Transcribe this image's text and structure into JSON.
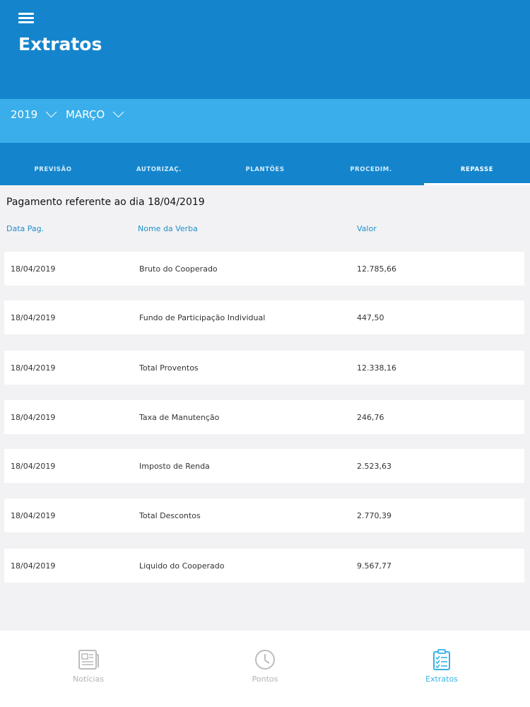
{
  "header": {
    "title": "Extratos"
  },
  "filters": {
    "year": "2019",
    "month": "MARÇO"
  },
  "tabs": [
    {
      "label": "PREVISÃO",
      "active": false
    },
    {
      "label": "AUTORIZAÇ.",
      "active": false
    },
    {
      "label": "PLANTÕES",
      "active": false
    },
    {
      "label": "PROCEDIM.",
      "active": false
    },
    {
      "label": "REPASSE",
      "active": true
    }
  ],
  "statement": {
    "title": "Pagamento referente ao dia 18/04/2019",
    "columns": {
      "date": "Data Pag.",
      "name": "Nome da Verba",
      "value": "Valor"
    },
    "rows": [
      {
        "date": "18/04/2019",
        "name": "Bruto do Cooperado",
        "value": "12.785,66"
      },
      {
        "date": "18/04/2019",
        "name": "Fundo de Participação Individual",
        "value": "447,50"
      },
      {
        "date": "18/04/2019",
        "name": "Total Proventos",
        "value": "12.338,16"
      },
      {
        "date": "18/04/2019",
        "name": "Taxa de Manutenção",
        "value": "246,76"
      },
      {
        "date": "18/04/2019",
        "name": "Imposto de Renda",
        "value": "2.523,63"
      },
      {
        "date": "18/04/2019",
        "name": "Total Descontos",
        "value": "2.770,39"
      },
      {
        "date": "18/04/2019",
        "name": "Liquido do Cooperado",
        "value": "9.567,77"
      }
    ]
  },
  "nav": [
    {
      "label": "Notícias",
      "icon": "newspaper-icon",
      "active": false
    },
    {
      "label": "Pontos",
      "icon": "clock-icon",
      "active": false
    },
    {
      "label": "Extratos",
      "icon": "clipboard-checklist-icon",
      "active": true
    }
  ],
  "colors": {
    "header": "#1485cc",
    "filter_bar": "#3aaeea",
    "accent": "#33b3e6",
    "column_heading": "#2190c9"
  }
}
